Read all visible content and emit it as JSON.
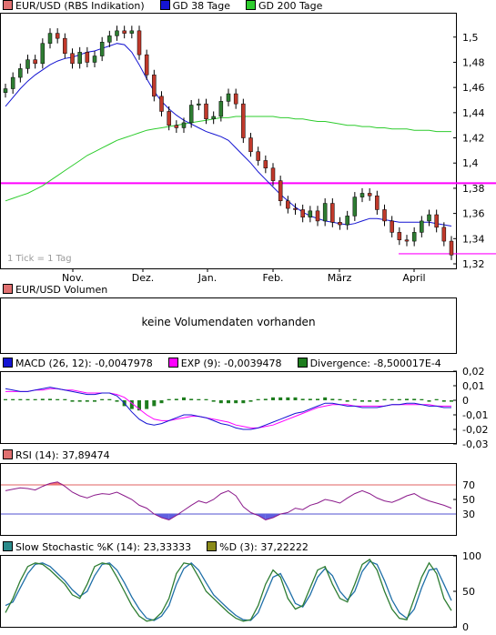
{
  "price": {
    "legend": [
      {
        "label": "EUR/USD (RBS Indikation)",
        "color": "#e07070"
      },
      {
        "label": "GD 38 Tage",
        "color": "#1414d2"
      },
      {
        "label": "GD 200 Tage",
        "color": "#2ecc2e"
      }
    ],
    "yticks": [
      "1,5",
      "1,48",
      "1,46",
      "1,44",
      "1,42",
      "1,4",
      "1,38",
      "1,36",
      "1,34",
      "1,32"
    ],
    "xticks": [
      "Nov.",
      "Dez.",
      "Jan.",
      "Feb.",
      "März",
      "April"
    ],
    "note": "1 Tick = 1 Tag",
    "colors": {
      "up": "#2e7d32",
      "down": "#c0392b",
      "line": "#ff00ff"
    }
  },
  "volume": {
    "legend": [
      {
        "label": "EUR/USD Volumen",
        "color": "#e07070"
      }
    ],
    "message": "keine Volumendaten vorhanden"
  },
  "macd": {
    "legend": [
      {
        "label": "MACD (26, 12): -0,0047978",
        "color": "#1414d2"
      },
      {
        "label": "EXP (9): -0,0039478",
        "color": "#ff00ff"
      },
      {
        "label": "Divergence: -8,500017E-4",
        "color": "#1e7d1e"
      }
    ],
    "yticks": [
      "0,02",
      "0,01",
      "0",
      "-0,01",
      "-0,02",
      "-0,03"
    ]
  },
  "rsi": {
    "legend": [
      {
        "label": "RSI (14): 37,89474",
        "color": "#e07070"
      }
    ],
    "yticks": [
      "70",
      "50",
      "30"
    ],
    "colors": {
      "upper": "#e06060",
      "lower": "#5050d0",
      "line": "#8b1a8b",
      "fill_up": "#f07070",
      "fill_dn": "#6060e0"
    }
  },
  "stoch": {
    "legend": [
      {
        "label": "Slow Stochastic %K (14): 23,33333",
        "color": "#2a8a8a"
      },
      {
        "label": "%D (3): 37,22222",
        "color": "#8a8a1a"
      }
    ],
    "yticks": [
      "100",
      "50",
      "0"
    ],
    "colors": {
      "k": "#2e7d32",
      "d": "#1f6fa8"
    }
  },
  "chart_data": [
    {
      "type": "candlestick",
      "title": "EUR/USD (RBS Indikation)",
      "ylim": [
        1.32,
        1.515
      ],
      "x": [
        "Nov.",
        "Dez.",
        "Jan.",
        "Feb.",
        "März",
        "April"
      ],
      "horizontal_lines": [
        1.384,
        1.328
      ],
      "series": [
        {
          "name": "EUR/USD (RBS Indikation)",
          "close": [
            1.459,
            1.468,
            1.475,
            1.482,
            1.479,
            1.495,
            1.503,
            1.499,
            1.487,
            1.479,
            1.488,
            1.48,
            1.485,
            1.496,
            1.501,
            1.505,
            1.503,
            1.505,
            1.486,
            1.47,
            1.453,
            1.441,
            1.43,
            1.428,
            1.432,
            1.446,
            1.447,
            1.435,
            1.437,
            1.449,
            1.455,
            1.447,
            1.42,
            1.409,
            1.402,
            1.396,
            1.386,
            1.37,
            1.364,
            1.363,
            1.357,
            1.362,
            1.354,
            1.368,
            1.353,
            1.351,
            1.358,
            1.373,
            1.376,
            1.374,
            1.363,
            1.354,
            1.345,
            1.339,
            1.338,
            1.345,
            1.354,
            1.359,
            1.349,
            1.338,
            1.327
          ]
        },
        {
          "name": "GD 38 Tage",
          "values": [
            1.445,
            1.452,
            1.459,
            1.465,
            1.47,
            1.474,
            1.478,
            1.481,
            1.483,
            1.484,
            1.486,
            1.488,
            1.489,
            1.491,
            1.493,
            1.495,
            1.494,
            1.488,
            1.478,
            1.467,
            1.457,
            1.449,
            1.443,
            1.438,
            1.434,
            1.431,
            1.428,
            1.425,
            1.423,
            1.421,
            1.418,
            1.412,
            1.406,
            1.4,
            1.393,
            1.387,
            1.381,
            1.375,
            1.37,
            1.365,
            1.361,
            1.358,
            1.356,
            1.354,
            1.353,
            1.352,
            1.351,
            1.352,
            1.354,
            1.356,
            1.356,
            1.355,
            1.354,
            1.353,
            1.353,
            1.353,
            1.353,
            1.353,
            1.352,
            1.351,
            1.35
          ]
        },
        {
          "name": "GD 200 Tage",
          "values": [
            1.37,
            1.372,
            1.374,
            1.376,
            1.379,
            1.382,
            1.386,
            1.39,
            1.394,
            1.398,
            1.402,
            1.406,
            1.409,
            1.412,
            1.415,
            1.418,
            1.42,
            1.422,
            1.424,
            1.426,
            1.427,
            1.428,
            1.429,
            1.43,
            1.431,
            1.432,
            1.433,
            1.434,
            1.435,
            1.436,
            1.436,
            1.437,
            1.437,
            1.437,
            1.437,
            1.437,
            1.437,
            1.436,
            1.436,
            1.435,
            1.435,
            1.434,
            1.433,
            1.433,
            1.432,
            1.431,
            1.43,
            1.43,
            1.429,
            1.429,
            1.428,
            1.428,
            1.427,
            1.427,
            1.427,
            1.426,
            1.426,
            1.426,
            1.425,
            1.425,
            1.425
          ]
        }
      ]
    },
    {
      "type": "line",
      "title": "MACD (26, 12)",
      "ylim": [
        -0.03,
        0.02
      ],
      "series": [
        {
          "name": "MACD (26, 12)",
          "values": [
            0.008,
            0.007,
            0.006,
            0.006,
            0.007,
            0.008,
            0.009,
            0.008,
            0.007,
            0.006,
            0.005,
            0.004,
            0.004,
            0.005,
            0.005,
            0.003,
            -0.002,
            -0.008,
            -0.013,
            -0.016,
            -0.017,
            -0.016,
            -0.014,
            -0.012,
            -0.01,
            -0.01,
            -0.011,
            -0.012,
            -0.014,
            -0.016,
            -0.017,
            -0.019,
            -0.02,
            -0.02,
            -0.019,
            -0.017,
            -0.015,
            -0.013,
            -0.011,
            -0.009,
            -0.008,
            -0.006,
            -0.004,
            -0.002,
            -0.002,
            -0.003,
            -0.004,
            -0.004,
            -0.005,
            -0.005,
            -0.005,
            -0.004,
            -0.003,
            -0.003,
            -0.002,
            -0.002,
            -0.003,
            -0.004,
            -0.004,
            -0.005,
            -0.005
          ]
        },
        {
          "name": "EXP (9)",
          "values": [
            0.006,
            0.006,
            0.006,
            0.006,
            0.007,
            0.007,
            0.008,
            0.008,
            0.007,
            0.007,
            0.006,
            0.005,
            0.005,
            0.005,
            0.005,
            0.004,
            0.002,
            -0.002,
            -0.006,
            -0.01,
            -0.013,
            -0.014,
            -0.014,
            -0.013,
            -0.012,
            -0.011,
            -0.011,
            -0.012,
            -0.013,
            -0.014,
            -0.015,
            -0.017,
            -0.018,
            -0.019,
            -0.019,
            -0.018,
            -0.017,
            -0.015,
            -0.013,
            -0.011,
            -0.009,
            -0.007,
            -0.005,
            -0.004,
            -0.003,
            -0.003,
            -0.003,
            -0.004,
            -0.004,
            -0.004,
            -0.004,
            -0.004,
            -0.003,
            -0.003,
            -0.003,
            -0.003,
            -0.003,
            -0.003,
            -0.004,
            -0.004,
            -0.004
          ]
        },
        {
          "name": "Divergence",
          "values": [
            0.0,
            0.0,
            0.0,
            0.0,
            0.0,
            0.001,
            0.001,
            0.0,
            0.0,
            -0.001,
            -0.001,
            -0.001,
            -0.001,
            0.0,
            0.0,
            -0.001,
            -0.004,
            -0.006,
            -0.007,
            -0.006,
            -0.004,
            -0.002,
            0.0,
            0.001,
            0.002,
            0.001,
            0.0,
            0.0,
            -0.001,
            -0.002,
            -0.002,
            -0.002,
            -0.002,
            -0.001,
            0.0,
            0.001,
            0.002,
            0.002,
            0.002,
            0.002,
            0.001,
            0.001,
            0.001,
            0.002,
            0.001,
            0.0,
            -0.001,
            0.0,
            -0.001,
            -0.001,
            -0.001,
            0.0,
            0.0,
            0.0,
            0.001,
            0.001,
            0.0,
            -0.001,
            0.0,
            -0.001,
            -0.001
          ]
        }
      ]
    },
    {
      "type": "line",
      "title": "RSI (14)",
      "ylim": [
        0,
        100
      ],
      "thresholds": [
        70,
        30
      ],
      "series": [
        {
          "name": "RSI (14)",
          "values": [
            62,
            64,
            66,
            65,
            63,
            68,
            72,
            74,
            68,
            60,
            55,
            52,
            56,
            58,
            57,
            60,
            55,
            50,
            42,
            38,
            30,
            25,
            22,
            28,
            35,
            42,
            48,
            45,
            50,
            58,
            62,
            55,
            40,
            32,
            28,
            22,
            25,
            30,
            32,
            38,
            36,
            42,
            45,
            50,
            48,
            45,
            52,
            58,
            62,
            58,
            52,
            48,
            46,
            50,
            55,
            58,
            52,
            48,
            45,
            42,
            38
          ]
        }
      ]
    },
    {
      "type": "line",
      "title": "Slow Stochastic %K (14)",
      "ylim": [
        0,
        100
      ],
      "series": [
        {
          "name": "Slow Stochastic %K (14)",
          "values": [
            20,
            40,
            65,
            85,
            90,
            88,
            80,
            70,
            60,
            45,
            40,
            60,
            85,
            90,
            88,
            70,
            50,
            30,
            15,
            8,
            10,
            20,
            40,
            75,
            90,
            88,
            70,
            50,
            40,
            30,
            20,
            12,
            8,
            10,
            30,
            60,
            80,
            70,
            40,
            25,
            30,
            55,
            80,
            85,
            60,
            40,
            35,
            60,
            88,
            95,
            80,
            50,
            25,
            12,
            10,
            40,
            70,
            90,
            75,
            40,
            23
          ]
        },
        {
          "name": "%D (3)",
          "values": [
            30,
            35,
            55,
            75,
            88,
            90,
            85,
            75,
            65,
            52,
            43,
            50,
            72,
            88,
            90,
            80,
            62,
            42,
            25,
            12,
            9,
            15,
            30,
            60,
            82,
            90,
            80,
            62,
            45,
            35,
            25,
            16,
            10,
            9,
            20,
            45,
            70,
            75,
            55,
            33,
            28,
            45,
            70,
            82,
            72,
            50,
            38,
            50,
            78,
            92,
            88,
            65,
            38,
            20,
            12,
            25,
            55,
            80,
            82,
            60,
            37
          ]
        }
      ]
    }
  ]
}
